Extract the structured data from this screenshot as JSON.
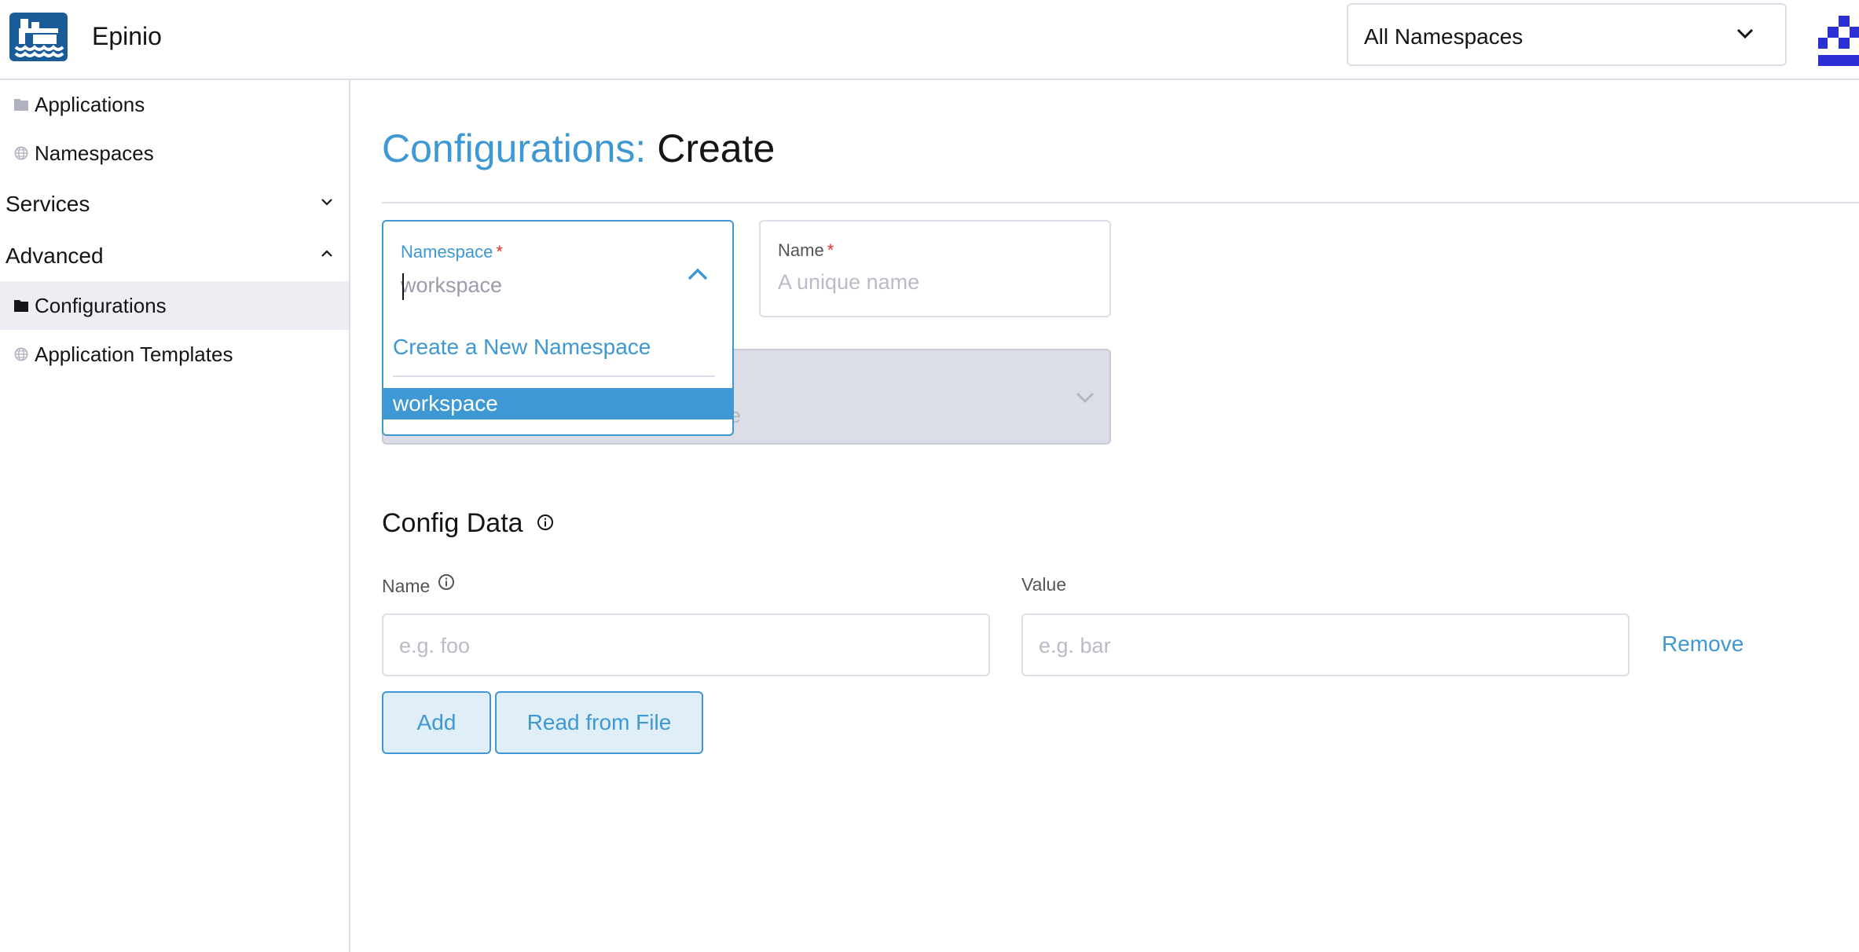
{
  "header": {
    "app_name": "Epinio",
    "namespace_filter": "All Namespaces"
  },
  "sidebar": {
    "items": [
      {
        "label": "Applications",
        "icon": "folder-icon"
      },
      {
        "label": "Namespaces",
        "icon": "globe-icon"
      }
    ],
    "groups": [
      {
        "label": "Services",
        "expanded": false
      },
      {
        "label": "Advanced",
        "expanded": true
      }
    ],
    "advanced_items": [
      {
        "label": "Configurations",
        "icon": "folder-icon",
        "active": true
      },
      {
        "label": "Application Templates",
        "icon": "globe-icon"
      }
    ]
  },
  "page": {
    "title_prefix": "Configurations:",
    "title_action": "Create"
  },
  "form": {
    "namespace": {
      "label": "Namespace",
      "required_mark": "*",
      "placeholder": "workspace",
      "dropdown": {
        "create_option": "Create a New Namespace",
        "options": [
          "workspace"
        ],
        "highlighted": "workspace"
      }
    },
    "name": {
      "label": "Name",
      "required_mark": "*",
      "placeholder": "A unique name"
    },
    "disabled_select_fragment": "e"
  },
  "config_data": {
    "title": "Config Data",
    "name_label": "Name",
    "value_label": "Value",
    "name_placeholder": "e.g. foo",
    "value_placeholder": "e.g. bar",
    "remove_label": "Remove",
    "add_label": "Add",
    "read_file_label": "Read from File"
  },
  "colors": {
    "accent": "#3d98d3",
    "logo_bg": "#1a5b98",
    "active_nav_bg": "#eceef3",
    "required": "#e03030"
  }
}
